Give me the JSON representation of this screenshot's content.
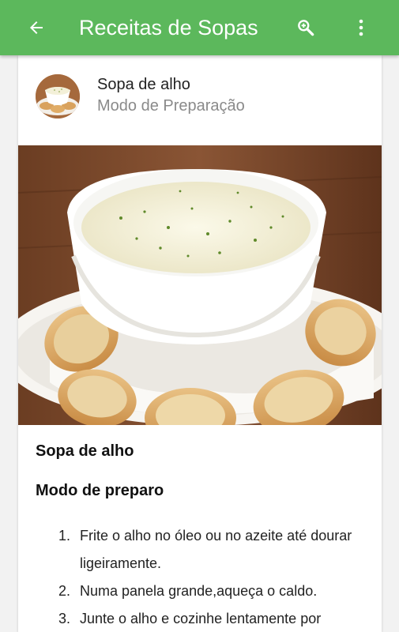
{
  "appbar": {
    "title": "Receitas de Sopas",
    "back_icon": "arrow-left-icon",
    "search_icon": "zoom-in-icon",
    "more_icon": "more-vertical-icon",
    "color": "#5cb85c"
  },
  "card": {
    "name": "Sopa de alho",
    "subtitle": "Modo de Preparação"
  },
  "recipe": {
    "title": "Sopa de alho",
    "section": "Modo de preparo",
    "steps": [
      {
        "num": "1.",
        "text": "Frite o alho no óleo ou no azeite até dourar ligeiramente."
      },
      {
        "num": "2.",
        "text": "Numa panela grande,aqueça o caldo."
      },
      {
        "num": "3.",
        "text": "Junte o alho e cozinhe lentamente por"
      }
    ]
  }
}
